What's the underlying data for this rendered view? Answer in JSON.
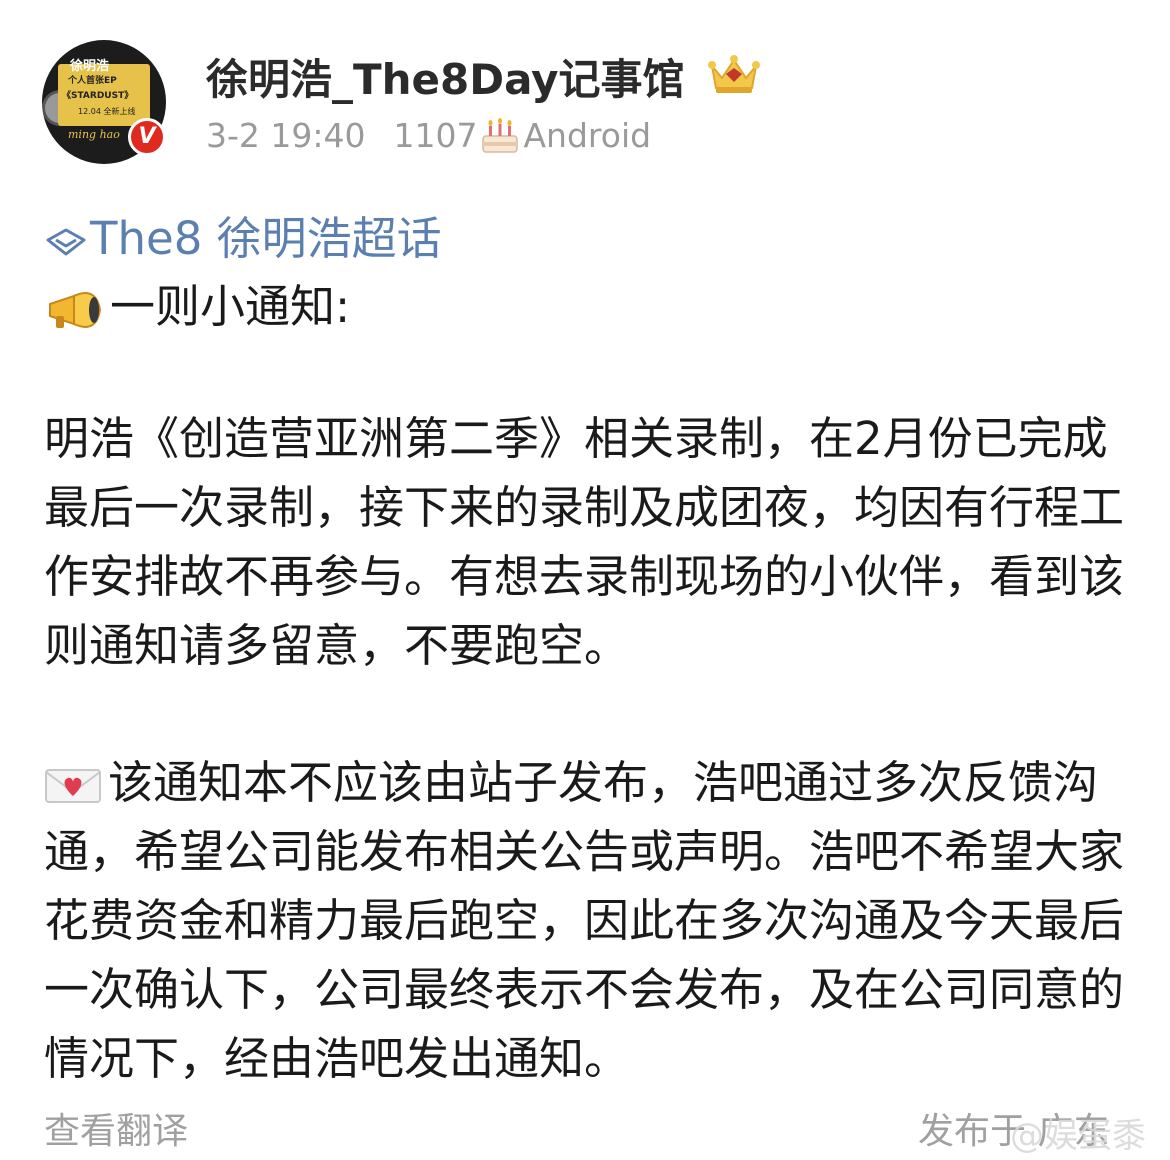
{
  "avatar": {
    "line1": "徐明浩",
    "line2": "个人首张EP",
    "line3": "《STARDUST》",
    "line4": "12.04 全新上线",
    "line5": "ming hao",
    "verified_badge": "V"
  },
  "header": {
    "name": "徐明浩_The8Day记事馆",
    "date": "3-2 19:40",
    "count": "1107",
    "source": "Android"
  },
  "post": {
    "topic": "The8 徐明浩超话",
    "notice_title": "一则小通知:",
    "paragraph1": "明浩《创造营亚洲第二季》相关录制，在2月份已完成最后一次录制，接下来的录制及成团夜，均因有行程工作安排故不再参与。有想去录制现场的小伙伴，看到该则通知请多留意，不要跑空。",
    "paragraph2": "该通知本不应该由站子发布，浩吧通过多次反馈沟通，希望公司能发布相关公告或声明。浩吧不希望大家花费资金和精力最后跑空，因此在多次沟通及今天最后一次确认下，公司最终表示不会发布，及在公司同意的情况下，经由浩吧发出通知。"
  },
  "footer": {
    "translate": "查看翻译",
    "publish": "发布于 广东",
    "watermark": "@娱蛋黍"
  },
  "colors": {
    "topic_blue": "#5b7fb1",
    "meta_gray": "#9a9a9a",
    "verified_red": "#e02a1f"
  }
}
